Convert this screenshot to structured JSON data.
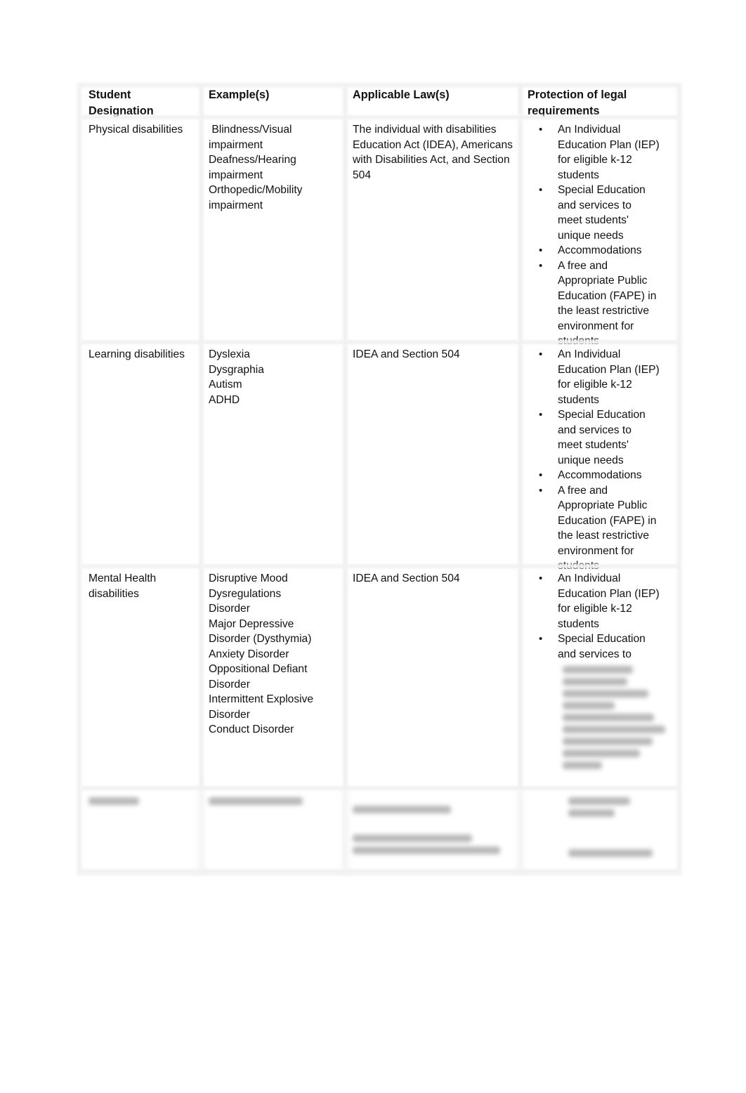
{
  "table": {
    "headers": [
      [
        "Student",
        "Designation"
      ],
      [
        "Example(s)"
      ],
      [
        "Applicable Law(s)"
      ],
      [
        "Protection of legal",
        "requirements"
      ]
    ],
    "rows": [
      {
        "designation": [
          "Physical disabilities"
        ],
        "examples": [
          " Blindness/Visual",
          "impairment",
          "Deafness/Hearing",
          "impairment",
          "Orthopedic/Mobility",
          "impairment"
        ],
        "laws": [
          "The individual with disabilities",
          "Education Act (IDEA), Americans",
          "with Disabilities Act, and Section",
          "504"
        ],
        "protections": [
          [
            "An Individual",
            "Education Plan (IEP)",
            "for eligible k-12",
            "students"
          ],
          [
            "Special Education",
            "and services to",
            "meet students'",
            "unique needs"
          ],
          [
            "Accommodations"
          ],
          [
            "A free and",
            "Appropriate Public",
            "Education (FAPE) in",
            "the least restrictive",
            "environment for",
            "students"
          ]
        ]
      },
      {
        "designation": [
          "Learning disabilities"
        ],
        "examples": [
          "Dyslexia",
          "Dysgraphia",
          "Autism",
          "ADHD"
        ],
        "laws": [
          "IDEA and Section 504"
        ],
        "protections": [
          [
            "An Individual",
            "Education Plan (IEP)",
            "for eligible k-12",
            "students"
          ],
          [
            "Special Education",
            "and services to",
            "meet students'",
            "unique needs"
          ],
          [
            "Accommodations"
          ],
          [
            "A free and",
            "Appropriate Public",
            "Education (FAPE) in",
            "the least restrictive",
            "environment for",
            "students"
          ]
        ]
      },
      {
        "designation": [
          "Mental Health",
          "disabilities"
        ],
        "examples": [
          "Disruptive Mood",
          "Dysregulations",
          "Disorder",
          "Major Depressive",
          "Disorder (Dysthymia)",
          "Anxiety Disorder",
          "Oppositional Defiant",
          "Disorder",
          "Intermittent Explosive",
          "Disorder",
          "Conduct Disorder"
        ],
        "laws": [
          "IDEA and Section 504"
        ],
        "protections": [
          [
            "An Individual",
            "Education Plan (IEP)",
            "for eligible k-12",
            "students"
          ],
          [
            "Special Education",
            "and services to"
          ]
        ]
      }
    ],
    "bullet_glyph": "•"
  }
}
